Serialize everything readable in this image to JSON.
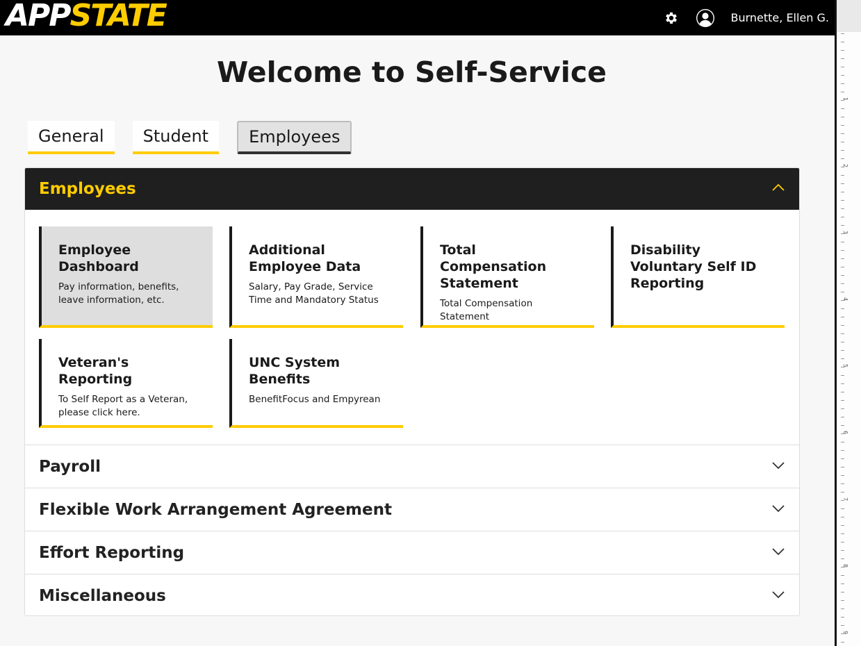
{
  "header": {
    "logo_left": "APP",
    "logo_right": "STATE",
    "user_name": "Burnette, Ellen G."
  },
  "page": {
    "title": "Welcome to Self-Service"
  },
  "tabs": [
    {
      "label": "General"
    },
    {
      "label": "Student"
    },
    {
      "label": "Employees",
      "active": true
    }
  ],
  "sections": {
    "employees": {
      "title": "Employees",
      "expanded": true,
      "cards": [
        {
          "title": "Employee Dashboard",
          "desc": "Pay information, benefits, leave information, etc."
        },
        {
          "title": "Additional Employee Data",
          "desc": "Salary, Pay Grade, Service Time and Mandatory Status"
        },
        {
          "title": "Total Compensation Statement",
          "desc": "Total Compensation Statement"
        },
        {
          "title": "Disability Voluntary Self ID Reporting",
          "desc": ""
        },
        {
          "title": "Veteran's Reporting",
          "desc": "To Self Report as a Veteran, please click here."
        },
        {
          "title": "UNC System Benefits",
          "desc": "BenefitFocus and Empyrean"
        }
      ]
    },
    "collapsed": [
      {
        "title": "Payroll"
      },
      {
        "title": "Flexible Work Arrangement Agreement"
      },
      {
        "title": "Effort Reporting"
      },
      {
        "title": "Miscellaneous"
      }
    ]
  },
  "ruler": {
    "numbers": [
      "1",
      "2",
      "3",
      "4",
      "5",
      "6",
      "7",
      "8",
      "9"
    ]
  },
  "colors": {
    "accent": "#ffcc00",
    "header_bg": "#000000",
    "panel_head_bg": "#1f1f1f"
  }
}
